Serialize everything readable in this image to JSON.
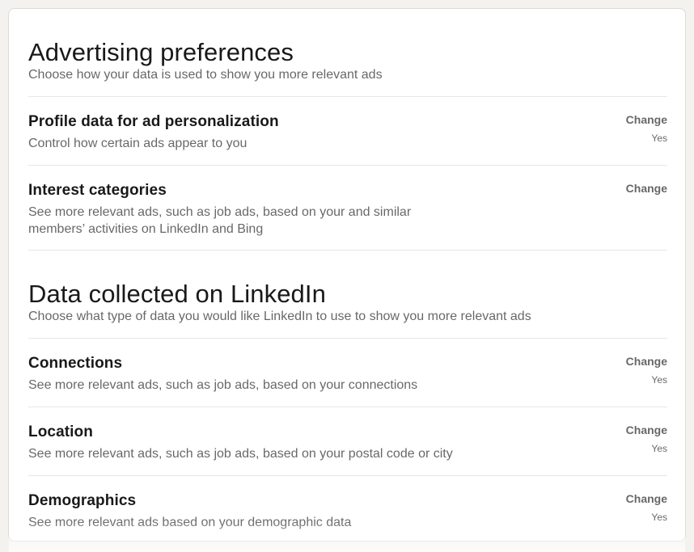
{
  "advertising": {
    "title": "Advertising preferences",
    "subtitle": "Choose how your data is used to show you more relevant ads",
    "items": [
      {
        "title": "Profile data for ad personalization",
        "description": "Control how certain ads appear to you",
        "action": "Change",
        "value": "Yes"
      },
      {
        "title": "Interest categories",
        "description": "See more relevant ads, such as job ads, based on your and similar members’ activities on LinkedIn and Bing",
        "action": "Change",
        "value": ""
      }
    ]
  },
  "data_collected": {
    "title": "Data collected on LinkedIn",
    "subtitle": "Choose what type of data you would like LinkedIn to use to show you more relevant ads",
    "items": [
      {
        "title": "Connections",
        "description": "See more relevant ads, such as job ads, based on your connections",
        "action": "Change",
        "value": "Yes"
      },
      {
        "title": "Location",
        "description": "See more relevant ads, such as job ads, based on your postal code or city",
        "action": "Change",
        "value": "Yes"
      },
      {
        "title": "Demographics",
        "description": "See more relevant ads based on your demographic data",
        "action": "Change",
        "value": "Yes"
      }
    ]
  }
}
